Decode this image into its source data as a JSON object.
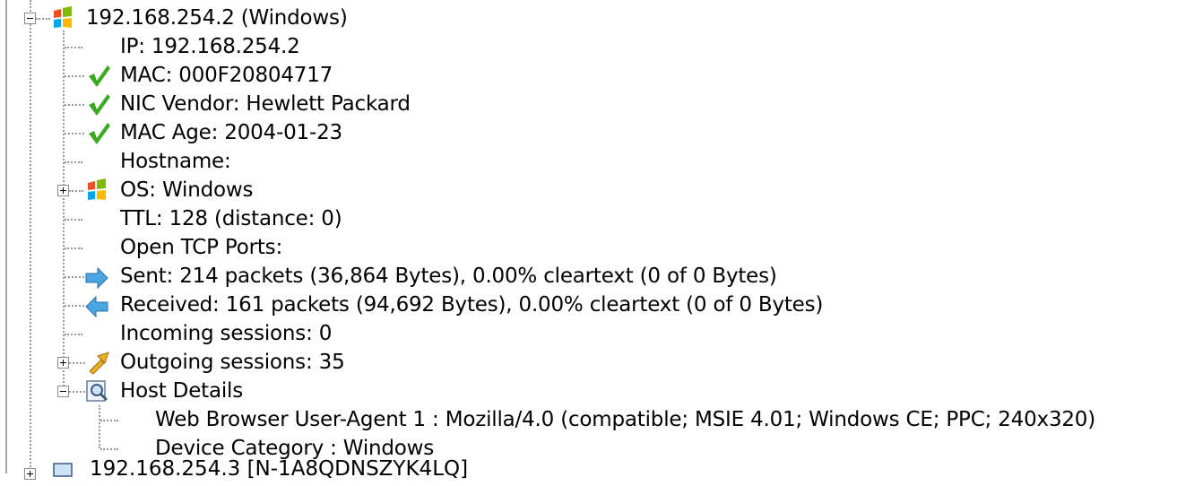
{
  "tree": {
    "host": {
      "label": "192.168.254.2 (Windows)",
      "icon": "windows-flag-icon",
      "children": [
        {
          "label": "IP: 192.168.254.2",
          "icon": "none"
        },
        {
          "label": "MAC: 000F20804717",
          "icon": "green-check-icon"
        },
        {
          "label": "NIC Vendor: Hewlett Packard",
          "icon": "green-check-icon"
        },
        {
          "label": "MAC Age: 2004-01-23",
          "icon": "green-check-icon"
        },
        {
          "label": "Hostname:",
          "icon": "none"
        },
        {
          "label": "OS: Windows",
          "icon": "windows-flag-icon"
        },
        {
          "label": "TTL: 128 (distance: 0)",
          "icon": "none"
        },
        {
          "label": "Open TCP Ports:",
          "icon": "none"
        },
        {
          "label": "Sent: 214 packets (36,864 Bytes), 0.00% cleartext (0 of 0 Bytes)",
          "icon": "blue-arrow-right-icon"
        },
        {
          "label": "Received: 161 packets (94,692 Bytes), 0.00% cleartext (0 of 0 Bytes)",
          "icon": "blue-arrow-left-icon"
        },
        {
          "label": "Incoming sessions: 0",
          "icon": "none"
        },
        {
          "label": "Outgoing sessions: 35",
          "icon": "yellow-arrow-icon"
        },
        {
          "label": "Host Details",
          "icon": "magnifier-icon"
        }
      ],
      "details": [
        {
          "label": "Web Browser User-Agent 1 : Mozilla/4.0 (compatible; MSIE 4.01; Windows CE; PPC; 240x320)"
        },
        {
          "label": "Device Category : Windows"
        }
      ]
    },
    "next_host_partial": "192.168.254.3 [N-1A8QDNSZYK4LQ]"
  },
  "colors": {
    "green_check": "#3aa820",
    "blue_arrow": "#4aa6e0",
    "yellow_arrow": "#e8b020",
    "dotted_line": "#9a9a9a"
  }
}
